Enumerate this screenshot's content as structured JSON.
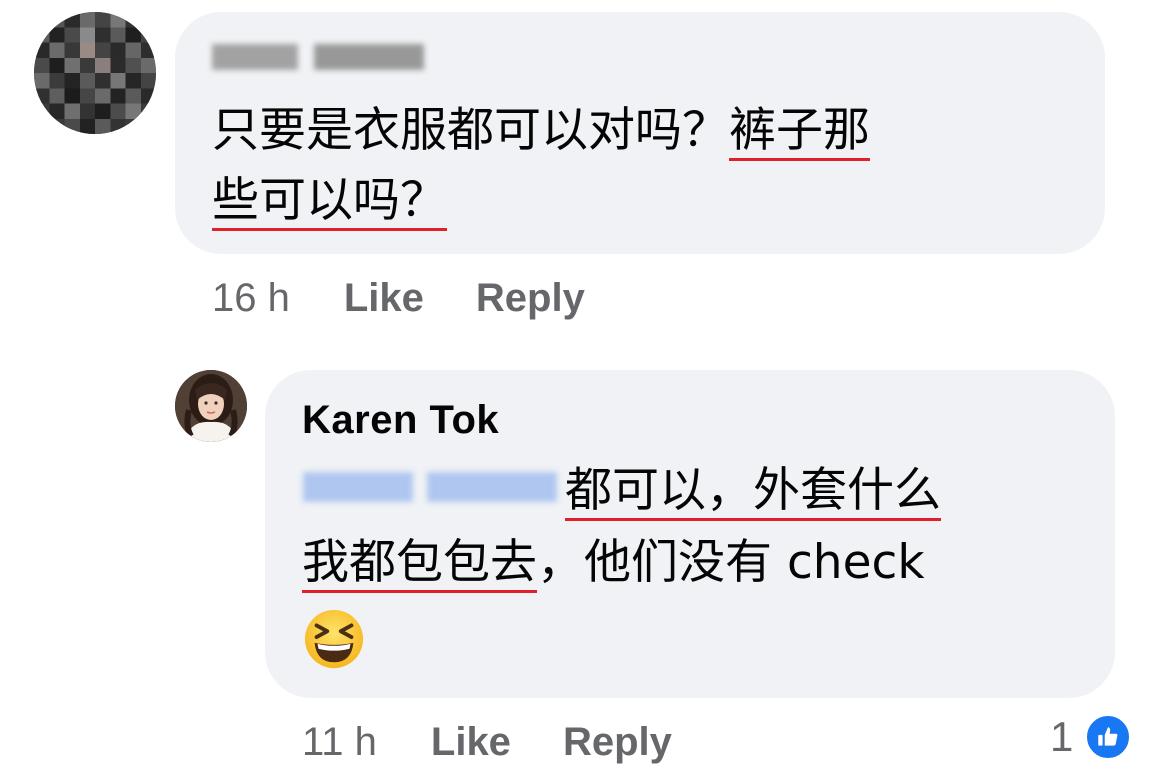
{
  "comment1": {
    "author_blurred": "",
    "text_line1_plain": "只要是衣服都可以对吗？",
    "text_line1_underlined": "裤子那",
    "text_line2_underlined": "些可以吗？",
    "time": "16 h",
    "like_label": "Like",
    "reply_label": "Reply",
    "avatar_icon": "pixelated-avatar-icon"
  },
  "reply1": {
    "author": "Karen Tok",
    "mention_blurred": "",
    "text_line1_underlined": "都可以，外套什么",
    "text_line2_underlined": "我都包包去",
    "text_line2_plain": "，他们没有 check",
    "emoji_icon": "grinning-squinting-emoji-icon",
    "time": "11 h",
    "like_label": "Like",
    "reply_label": "Reply",
    "reaction_count": "1",
    "reaction_icon": "thumbs-up-icon"
  },
  "colors": {
    "bubble_bg": "#f0f2f5",
    "underline": "#e0202a",
    "meta_text": "#65676b",
    "like_blue": "#1877f2"
  }
}
